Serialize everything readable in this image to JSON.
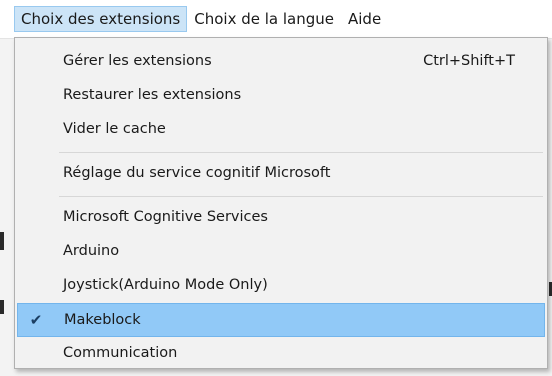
{
  "menubar": {
    "items": [
      {
        "label": "Choix des extensions",
        "active": true
      },
      {
        "label": "Choix de la langue",
        "active": false
      },
      {
        "label": "Aide",
        "active": false
      }
    ]
  },
  "dropdown": {
    "items": [
      {
        "label": "Gérer les extensions",
        "shortcut": "Ctrl+Shift+T"
      },
      {
        "label": "Restaurer les extensions"
      },
      {
        "label": "Vider le cache"
      },
      {
        "label": "Réglage du service cognitif Microsoft"
      },
      {
        "label": "Microsoft Cognitive Services"
      },
      {
        "label": "Arduino"
      },
      {
        "label": "Joystick(Arduino Mode Only)"
      },
      {
        "label": "Makeblock",
        "checked": true,
        "check_glyph": "✔"
      },
      {
        "label": "Communication"
      }
    ]
  },
  "colors": {
    "menubar_active_bg": "#cce4f7",
    "selected_item_bg": "#91c9f7",
    "menu_bg": "#f2f2f2"
  }
}
